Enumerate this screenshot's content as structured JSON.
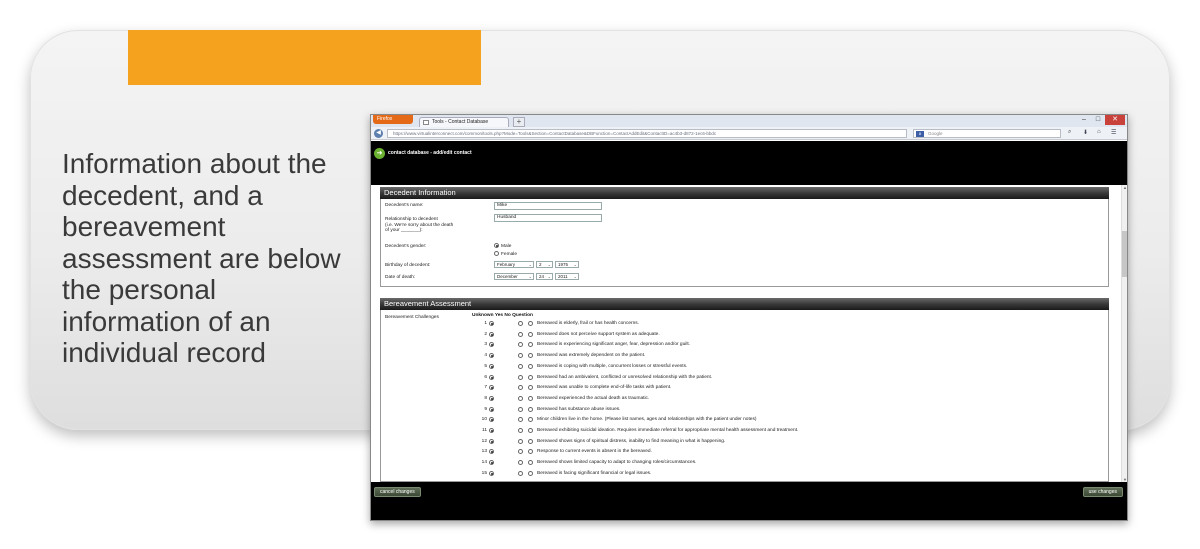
{
  "slide": {
    "caption": "Information about the decedent, and a bereavement assessment are below the personal information of an individual record"
  },
  "browser": {
    "firefox_label": "Firefox",
    "tab_title": "Tools - Contact Database",
    "new_tab": "+",
    "url": "https://www.virtualinterconnect.com/common/tools.php?Mode=Tools&Section=ContactDatabase&DBFunction=ContactAddEdit&ContactID=ac4b3-d872-1ec6-bbdc",
    "search_placeholder": "Google",
    "search_badge": "8"
  },
  "app": {
    "title": "contact database - add/edit contact"
  },
  "decedent": {
    "header": "Decedent Information",
    "name_label": "Decedent's name:",
    "name_value": "Mike",
    "relationship_label": "Relationship to decedent\n(i.e. We're sorry about the death\nof your _______):",
    "relationship_value": "Husband",
    "gender_label": "Decedent's gender:",
    "gender_options": [
      "Male",
      "Female"
    ],
    "gender_selected": "Male",
    "birthday_label": "Birthday of decedent:",
    "birthday": {
      "month": "February",
      "day": "2",
      "year": "1975"
    },
    "death_label": "Date of death:",
    "death": {
      "month": "December",
      "day": "24",
      "year": "2011"
    }
  },
  "bereavement": {
    "header": "Bereavement Assessment",
    "challenges_label": "Bereavement Challenges",
    "col_headers": "Unknown Yes No Question",
    "questions": [
      {
        "n": "1",
        "q": "Bereaved is elderly, frail or has health concerns."
      },
      {
        "n": "2",
        "q": "Bereaved does not perceive support system as adequate."
      },
      {
        "n": "3",
        "q": "Bereaved is experiencing significant anger, fear, depression and/or guilt."
      },
      {
        "n": "4",
        "q": "Bereaved was extremely dependent on the patient."
      },
      {
        "n": "5",
        "q": "Bereaved is coping with multiple, concurrent losses or stressful events."
      },
      {
        "n": "6",
        "q": "Bereaved had an ambivalent, conflicted or unresolved relationship with the patient."
      },
      {
        "n": "7",
        "q": "Bereaved was unable to complete end-of-life tasks with patient."
      },
      {
        "n": "8",
        "q": "Bereaved experienced the actual death as traumatic."
      },
      {
        "n": "9",
        "q": "Bereaved has substance abuse issues."
      },
      {
        "n": "10",
        "q": "Minor children live in the home. (Please list names, ages and relationships with the patient under notes)"
      },
      {
        "n": "11",
        "q": "Bereaved exhibiting suicidal ideation. Requires immediate referral for appropriate mental health assessment and treatment."
      },
      {
        "n": "12",
        "q": "Bereaved shows signs of spiritual distress, inability to find meaning in what is happening."
      },
      {
        "n": "13",
        "q": "Response to current events is absent in the bereaved."
      },
      {
        "n": "14",
        "q": "Bereaved shows limited capacity to adapt to changing roles/circumstances."
      },
      {
        "n": "15",
        "q": "Bereaved is facing significant financial or legal issues."
      }
    ]
  },
  "footer": {
    "cancel_label": "cancel changes",
    "save_label": "use changes"
  },
  "colors": {
    "accent": "#f5a31f",
    "header_bar": "#000000",
    "button": "#4a5842"
  }
}
